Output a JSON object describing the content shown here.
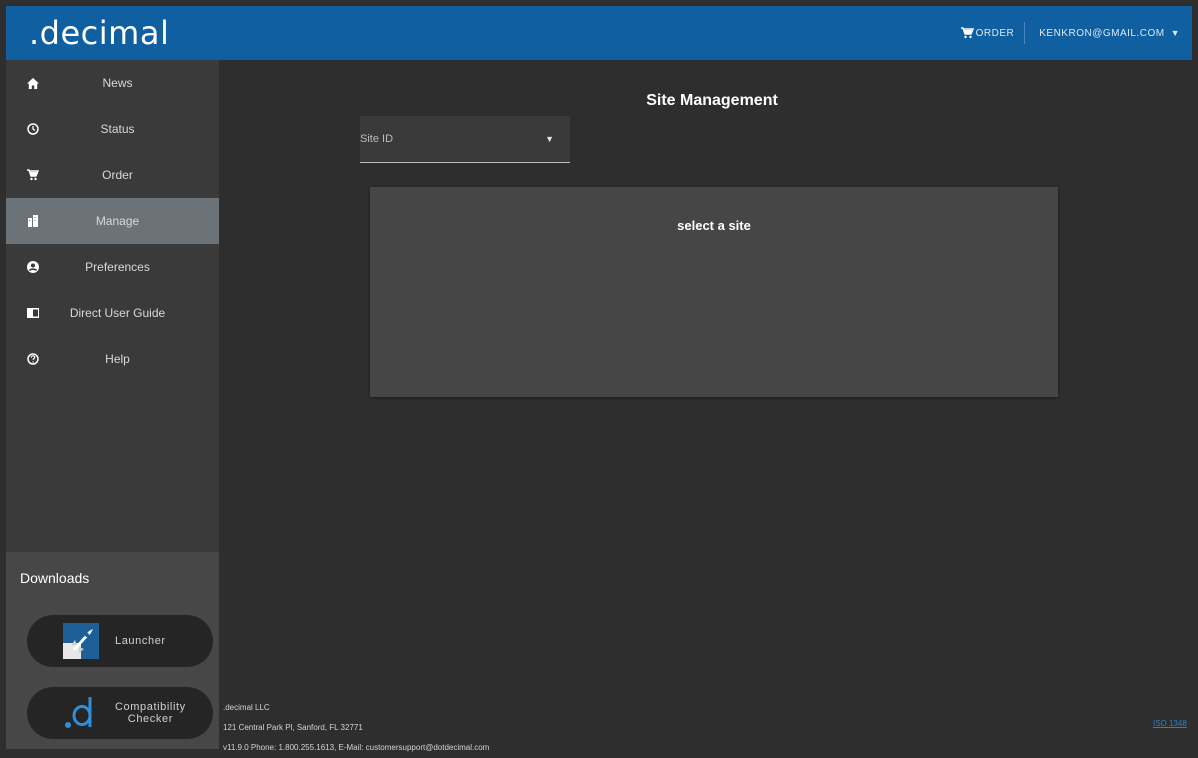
{
  "header": {
    "logo": ".decimal",
    "order_label": "ORDER",
    "account_email": "KENKRON@GMAIL.COM",
    "account_caret": "▼"
  },
  "sidebar": {
    "items": [
      {
        "label": "News",
        "icon": "home-icon",
        "active": false
      },
      {
        "label": "Status",
        "icon": "clock-icon",
        "active": false
      },
      {
        "label": "Order",
        "icon": "cart-icon",
        "active": false
      },
      {
        "label": "Manage",
        "icon": "buildings-icon",
        "active": true
      },
      {
        "label": "Preferences",
        "icon": "account-icon",
        "active": false
      },
      {
        "label": "Direct User Guide",
        "icon": "book-icon",
        "active": false
      },
      {
        "label": "Help",
        "icon": "help-icon",
        "active": false
      }
    ],
    "downloads": {
      "title": "Downloads",
      "launcher_label": "Launcher",
      "compat_label_1": "Compatibility",
      "compat_label_2": "Checker"
    }
  },
  "main": {
    "title": "Site Management",
    "site_select": {
      "label": "Site ID",
      "caret": "▼"
    },
    "panel_text": "select a site"
  },
  "footer": {
    "company": ".decimal LLC",
    "address": "121 Central Park Pl, Sanford, FL 32771",
    "contact": "v11.9.0 Phone: 1.800.255.1613, E-Mail: customersupport@dotdecimal.com",
    "iso_link": "ISO 1348"
  },
  "colors": {
    "header_bg": "#0f5fa1",
    "sidebar_bg": "#3a3a3a",
    "active_item_bg": "#6b7378",
    "main_bg": "#2e2e2e",
    "panel_bg": "#464646",
    "link": "#2f7fc4"
  }
}
